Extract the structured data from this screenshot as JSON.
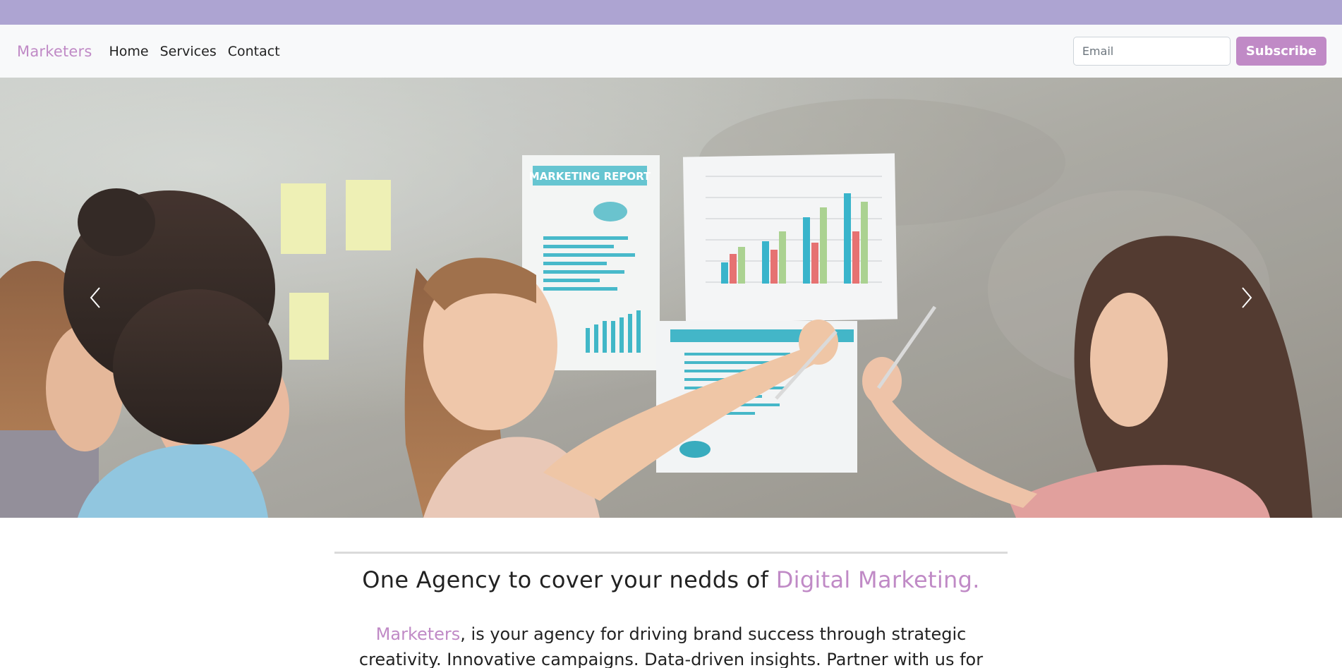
{
  "colors": {
    "topbar": "#ada4d2",
    "accent": "#c08ac6",
    "navbar_bg": "#f8f9fa"
  },
  "navbar": {
    "brand": "Marketers",
    "links": [
      "Home",
      "Services",
      "Contact"
    ],
    "email_placeholder": "Email",
    "subscribe_label": "Subscribe"
  },
  "hero": {
    "report_title": "MARKETING REPORT",
    "prev_icon": "chevron-left-icon",
    "next_icon": "chevron-right-icon"
  },
  "intro": {
    "headline_prefix": "One Agency to cover your nedds of ",
    "headline_accent": "Digital Marketing.",
    "about_brand": "Marketers",
    "about_text": ", is your agency for driving brand success through strategic creativity. Innovative campaigns. Data-driven insights. Partner with us for"
  }
}
